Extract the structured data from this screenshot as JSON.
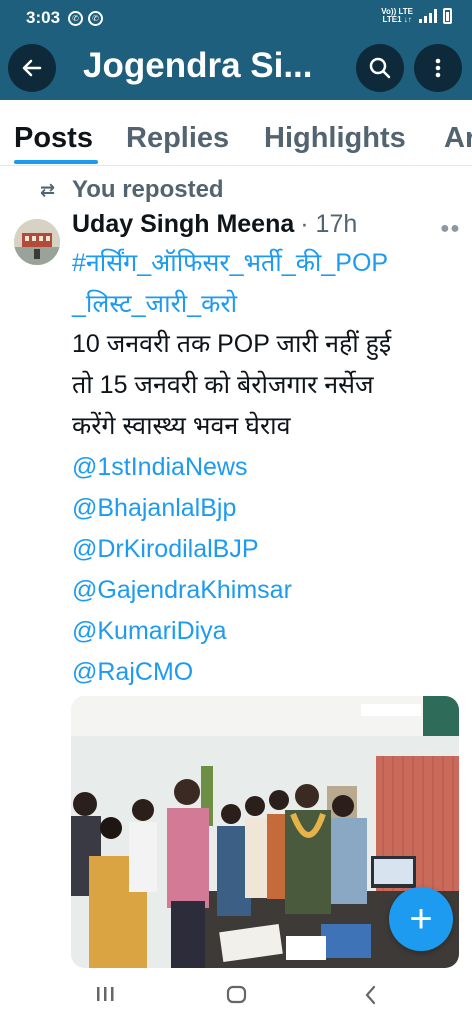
{
  "status_bar": {
    "time": "3:03",
    "network_line1": "Vo)) LTE",
    "network_line2": "LTE1 ↓↑"
  },
  "header": {
    "title": "Jogendra Si...",
    "icons": [
      "back-arrow-icon",
      "search-icon",
      "more-vertical-icon"
    ]
  },
  "tabs": [
    {
      "label": "Posts",
      "active": true
    },
    {
      "label": "Replies",
      "active": false
    },
    {
      "label": "Highlights",
      "active": false
    },
    {
      "label": "Ar",
      "active": false
    }
  ],
  "post": {
    "repost_label": "You reposted",
    "author": "Uday Singh Meena",
    "time": "· 17h",
    "hashtag_line1": "#नर्सिंग_ऑफिसर_भर्ती_की_POP",
    "hashtag_line2": "_लिस्ट_जारी_करो",
    "body_line1": "10 जनवरी तक POP जारी नहीं हुई",
    "body_line2": "तो 15 जनवरी को बेरोजगार नर्सेज",
    "body_line3": "करेंगे स्वास्थ्य भवन घेराव",
    "mentions": [
      "@1stIndiaNews",
      "@BhajanlalBjp",
      "@DrKirodilalBJP",
      "@GajendraKhimsar",
      "@KumariDiya",
      "@RajCMO"
    ]
  },
  "colors": {
    "header_bg": "#1d5f7c",
    "accent": "#1d9bf0",
    "text": "#0f1419",
    "muted": "#536471"
  },
  "fab": {
    "label": "+"
  }
}
